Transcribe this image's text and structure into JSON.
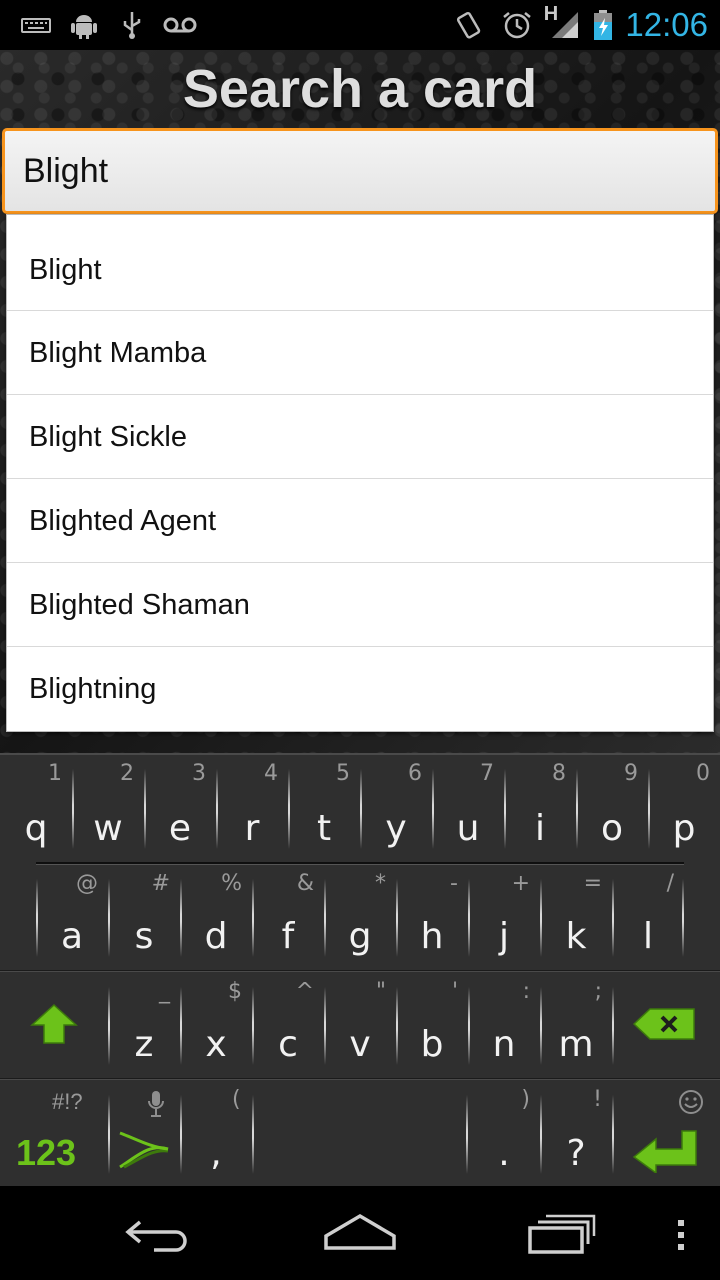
{
  "status_bar": {
    "time": "12:06",
    "network_label": "H",
    "left_icons": [
      "keyboard-icon",
      "android-debug-icon",
      "usb-icon",
      "voicemail-icon"
    ],
    "right_icons": [
      "vibrate-icon",
      "alarm-icon",
      "signal-icon",
      "battery-charging-icon"
    ]
  },
  "app": {
    "title": "Search a card",
    "search": {
      "value": "Blight",
      "placeholder": ""
    },
    "suggestions": [
      "Blight",
      "Blight Mamba",
      "Blight Sickle",
      "Blighted Agent",
      "Blighted Shaman",
      "Blightning"
    ]
  },
  "keyboard": {
    "row1": [
      {
        "main": "q",
        "alt": "1"
      },
      {
        "main": "w",
        "alt": "2"
      },
      {
        "main": "e",
        "alt": "3"
      },
      {
        "main": "r",
        "alt": "4"
      },
      {
        "main": "t",
        "alt": "5"
      },
      {
        "main": "y",
        "alt": "6"
      },
      {
        "main": "u",
        "alt": "7"
      },
      {
        "main": "i",
        "alt": "8"
      },
      {
        "main": "o",
        "alt": "9"
      },
      {
        "main": "p",
        "alt": "0"
      }
    ],
    "row2": [
      {
        "main": "a",
        "alt": "@"
      },
      {
        "main": "s",
        "alt": "#"
      },
      {
        "main": "d",
        "alt": "%"
      },
      {
        "main": "f",
        "alt": "&"
      },
      {
        "main": "g",
        "alt": "*"
      },
      {
        "main": "h",
        "alt": "-"
      },
      {
        "main": "j",
        "alt": "+"
      },
      {
        "main": "k",
        "alt": "="
      },
      {
        "main": "l",
        "alt": "/"
      }
    ],
    "row3": [
      {
        "main": "z",
        "alt": "_"
      },
      {
        "main": "x",
        "alt": "$"
      },
      {
        "main": "c",
        "alt": "^"
      },
      {
        "main": "v",
        "alt": "\""
      },
      {
        "main": "b",
        "alt": "'"
      },
      {
        "main": "n",
        "alt": ":"
      },
      {
        "main": "m",
        "alt": ";"
      }
    ],
    "row4": {
      "num_label": "123",
      "num_alt": "#!?",
      "comma": {
        "main": ",",
        "alt": "("
      },
      "period": {
        "main": ".",
        "alt": ")"
      },
      "question": {
        "main": "?",
        "alt": "!"
      }
    },
    "accent_color": "#6cc21a"
  },
  "nav_bar": {
    "buttons": [
      "back-icon",
      "home-icon",
      "recent-apps-icon",
      "menu-icon"
    ]
  }
}
